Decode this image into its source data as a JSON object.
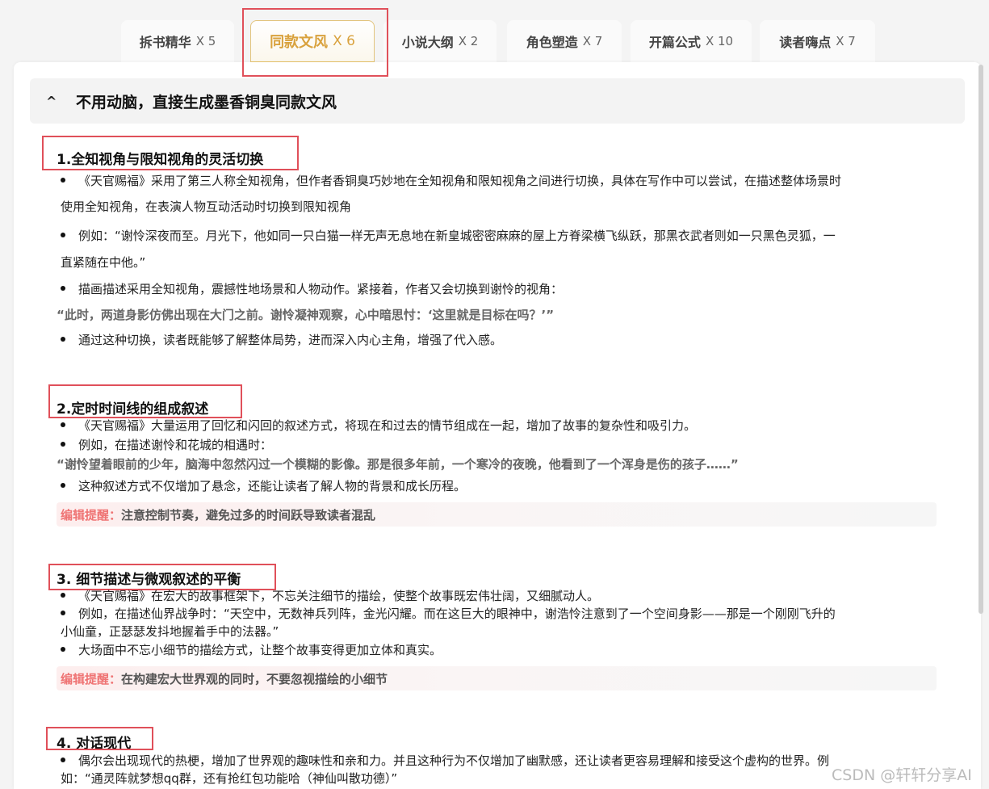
{
  "tabs": [
    {
      "label": "拆书精华",
      "count": "X 5"
    },
    {
      "label": "同款文风",
      "count": "X 6"
    },
    {
      "label": "小说大纲",
      "count": "X 2"
    },
    {
      "label": "角色塑造",
      "count": "X 7"
    },
    {
      "label": "开篇公式",
      "count": "X 10"
    },
    {
      "label": "读者嗨点",
      "count": "X 7"
    }
  ],
  "section": {
    "caret": "^",
    "title": "不用动脑，直接生成墨香铜臭同款文风"
  },
  "s1": {
    "heading": "1.全知视角与限知视角的灵活切换",
    "b1a": "《天官赐福》采用了第三人称全知视角，但作者香铜臭巧妙地在全知视角和限知视角之间进行切换，具体在写作中可以尝试，在描述整体场景时",
    "b1b": "使用全知视角，在表演人物互动活动时切换到限知视角",
    "b2a": "例如：“谢怜深夜而至。月光下，他如同一只白猫一样无声无息地在新皇城密密麻麻的屋上方脊梁横飞纵跃，那黑衣武者则如一只黑色灵狐，一",
    "b2b": "直紧随在中他。”",
    "b3": "描画描述采用全知视角，震撼性地场景和人物动作。紧接着，作者又会切换到谢怜的视角：",
    "quote": "“此时，两道身影仿佛出现在大门之前。谢怜凝神观察，心中暗思忖：‘这里就是目标在吗？’”",
    "b4": "通过这种切换，读者既能够了解整体局势，进而深入内心主角，增强了代入感。"
  },
  "s2": {
    "heading": "2.定时时间线的组成叙述",
    "b1": "《天官赐福》大量运用了回忆和闪回的叙述方式，将现在和过去的情节组成在一起，增加了故事的复杂性和吸引力。",
    "b2": "例如，在描述谢怜和花城的相遇时：",
    "quote": "“谢怜望着眼前的少年，脑海中忽然闪过一个模糊的影像。那是很多年前，一个寒冷的夜晚，他看到了一个浑身是伤的孩子……”",
    "b3": "这种叙述方式不仅增加了悬念，还能让读者了解人物的背景和成长历程。",
    "tip_label": "编辑提醒：",
    "tip_text": "注意控制节奏，避免过多的时间跃导致读者混乱"
  },
  "s3": {
    "heading": "3. 细节描述与微观叙述的平衡",
    "b1": "《天官赐福》在宏大的故事框架下，不忘关注细节的描绘，使整个故事既宏伟壮阔，又细腻动人。",
    "b2a": "例如，在描述仙界战争时：“天空中，无数神兵列阵，金光闪耀。而在这巨大的眼神中，谢浩怜注意到了一个空间身影——那是一个刚刚飞升的",
    "b2b": "小仙童，正瑟瑟发抖地握着手中的法器。”",
    "b3": "大场面中不忘小细节的描绘方式，让整个故事变得更加立体和真实。",
    "tip_label": "编辑提醒：",
    "tip_text": "在构建宏大世界观的同时，不要忽视描绘的小细节"
  },
  "s4": {
    "heading": "4. 对话现代",
    "b1a": "偶尔会出现现代的热梗，增加了世界观的趣味性和亲和力。并且这种行为不仅增加了幽默感，还让读者更容易理解和接受这个虚构的世界。例",
    "b1b": "如：“通灵阵就梦想qq群，还有抢红包功能哈（神仙叫散功德）”"
  },
  "watermark": "CSDN @轩轩分享AI",
  "colors": {
    "accent": "#d9a23e",
    "highlight_box": "#e0505a",
    "tip_label": "#ef7474"
  }
}
